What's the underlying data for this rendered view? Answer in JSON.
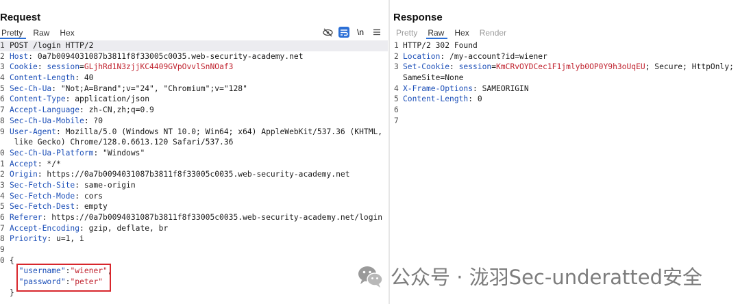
{
  "request": {
    "title": "Request",
    "tabs": [
      {
        "label": "Pretty",
        "active": true
      },
      {
        "label": "Raw",
        "active": false
      },
      {
        "label": "Hex",
        "active": false
      }
    ],
    "tools": {
      "newline_label": "\\n"
    },
    "lines": [
      {
        "n": "1",
        "parts": [
          {
            "t": "POST /login HTTP/2",
            "c": ""
          }
        ]
      },
      {
        "n": "2",
        "parts": [
          {
            "t": "Host",
            "c": "hdr"
          },
          {
            "t": ": 0a7b0094031087b3811f8f33005c0035.web-security-academy.net",
            "c": ""
          }
        ]
      },
      {
        "n": "3",
        "parts": [
          {
            "t": "Cookie",
            "c": "hdr"
          },
          {
            "t": ": ",
            "c": ""
          },
          {
            "t": "session",
            "c": "hdr"
          },
          {
            "t": "=",
            "c": ""
          },
          {
            "t": "GLjhRd1N3zjjKC4409GVpOvvlSnNOaf3",
            "c": "val"
          }
        ]
      },
      {
        "n": "4",
        "parts": [
          {
            "t": "Content-Length",
            "c": "hdr"
          },
          {
            "t": ": 40",
            "c": ""
          }
        ]
      },
      {
        "n": "5",
        "parts": [
          {
            "t": "Sec-Ch-Ua",
            "c": "hdr"
          },
          {
            "t": ": \"Not;A=Brand\";v=\"24\", \"Chromium\";v=\"128\"",
            "c": ""
          }
        ]
      },
      {
        "n": "6",
        "parts": [
          {
            "t": "Content-Type",
            "c": "hdr"
          },
          {
            "t": ": application/json",
            "c": ""
          }
        ]
      },
      {
        "n": "7",
        "parts": [
          {
            "t": "Accept-Language",
            "c": "hdr"
          },
          {
            "t": ": zh-CN,zh;q=0.9",
            "c": ""
          }
        ]
      },
      {
        "n": "8",
        "parts": [
          {
            "t": "Sec-Ch-Ua-Mobile",
            "c": "hdr"
          },
          {
            "t": ": ?0",
            "c": ""
          }
        ]
      },
      {
        "n": "9",
        "parts": [
          {
            "t": "User-Agent",
            "c": "hdr"
          },
          {
            "t": ": Mozilla/5.0 (Windows NT 10.0; Win64; x64) AppleWebKit/537.36 (KHTML,",
            "c": ""
          }
        ]
      },
      {
        "n": "",
        "parts": [
          {
            "t": " like Gecko) Chrome/128.0.6613.120 Safari/537.36",
            "c": ""
          }
        ]
      },
      {
        "n": "0",
        "parts": [
          {
            "t": "Sec-Ch-Ua-Platform",
            "c": "hdr"
          },
          {
            "t": ": \"Windows\"",
            "c": ""
          }
        ]
      },
      {
        "n": "1",
        "parts": [
          {
            "t": "Accept",
            "c": "hdr"
          },
          {
            "t": ": */*",
            "c": ""
          }
        ]
      },
      {
        "n": "2",
        "parts": [
          {
            "t": "Origin",
            "c": "hdr"
          },
          {
            "t": ": https://0a7b0094031087b3811f8f33005c0035.web-security-academy.net",
            "c": ""
          }
        ]
      },
      {
        "n": "3",
        "parts": [
          {
            "t": "Sec-Fetch-Site",
            "c": "hdr"
          },
          {
            "t": ": same-origin",
            "c": ""
          }
        ]
      },
      {
        "n": "4",
        "parts": [
          {
            "t": "Sec-Fetch-Mode",
            "c": "hdr"
          },
          {
            "t": ": cors",
            "c": ""
          }
        ]
      },
      {
        "n": "5",
        "parts": [
          {
            "t": "Sec-Fetch-Dest",
            "c": "hdr"
          },
          {
            "t": ": empty",
            "c": ""
          }
        ]
      },
      {
        "n": "6",
        "parts": [
          {
            "t": "Referer",
            "c": "hdr"
          },
          {
            "t": ": https://0a7b0094031087b3811f8f33005c0035.web-security-academy.net/login",
            "c": ""
          }
        ]
      },
      {
        "n": "7",
        "parts": [
          {
            "t": "Accept-Encoding",
            "c": "hdr"
          },
          {
            "t": ": gzip, deflate, br",
            "c": ""
          }
        ]
      },
      {
        "n": "8",
        "parts": [
          {
            "t": "Priority",
            "c": "hdr"
          },
          {
            "t": ": u=1, i",
            "c": ""
          }
        ]
      },
      {
        "n": "9",
        "parts": [
          {
            "t": "",
            "c": ""
          }
        ]
      },
      {
        "n": "0",
        "parts": [
          {
            "t": "{",
            "c": ""
          }
        ]
      },
      {
        "n": "",
        "parts": [
          {
            "t": "  ",
            "c": ""
          },
          {
            "t": "\"username\"",
            "c": "jkey"
          },
          {
            "t": ":",
            "c": ""
          },
          {
            "t": "\"wiener\"",
            "c": "jstr"
          },
          {
            "t": ",",
            "c": ""
          }
        ]
      },
      {
        "n": "",
        "parts": [
          {
            "t": "  ",
            "c": ""
          },
          {
            "t": "\"password\"",
            "c": "jkey"
          },
          {
            "t": ":",
            "c": ""
          },
          {
            "t": "\"peter\"",
            "c": "jstr"
          }
        ]
      },
      {
        "n": "",
        "parts": [
          {
            "t": "}",
            "c": ""
          }
        ]
      }
    ]
  },
  "response": {
    "title": "Response",
    "tabs": [
      {
        "label": "Pretty",
        "active": false,
        "disabled": true
      },
      {
        "label": "Raw",
        "active": true
      },
      {
        "label": "Hex",
        "active": false
      },
      {
        "label": "Render",
        "active": false,
        "disabled": true
      }
    ],
    "lines": [
      {
        "n": "1",
        "parts": [
          {
            "t": "HTTP/2 302 Found",
            "c": ""
          }
        ]
      },
      {
        "n": "2",
        "parts": [
          {
            "t": "Location",
            "c": "hdr"
          },
          {
            "t": ": /my-account?id=wiener",
            "c": ""
          }
        ]
      },
      {
        "n": "3",
        "parts": [
          {
            "t": "Set-Cookie",
            "c": "hdr"
          },
          {
            "t": ": ",
            "c": ""
          },
          {
            "t": "session",
            "c": "hdr"
          },
          {
            "t": "=",
            "c": ""
          },
          {
            "t": "KmCRvOYDCec1F1jmlyb0OP0Y9h3oUqEU",
            "c": "val"
          },
          {
            "t": "; Secure; HttpOnly;",
            "c": ""
          }
        ]
      },
      {
        "n": "",
        "parts": [
          {
            "t": "SameSite=None",
            "c": ""
          }
        ]
      },
      {
        "n": "4",
        "parts": [
          {
            "t": "X-Frame-Options",
            "c": "hdr"
          },
          {
            "t": ": SAMEORIGIN",
            "c": ""
          }
        ]
      },
      {
        "n": "5",
        "parts": [
          {
            "t": "Content-Length",
            "c": "hdr"
          },
          {
            "t": ": 0",
            "c": ""
          }
        ]
      },
      {
        "n": "6",
        "parts": [
          {
            "t": "",
            "c": ""
          }
        ]
      },
      {
        "n": "7",
        "parts": [
          {
            "t": "",
            "c": ""
          }
        ]
      }
    ]
  },
  "watermark": {
    "text": "公众号 · 泷羽Sec-underatted安全"
  },
  "colors": {
    "accent": "#2b6fd6",
    "header_name": "#1c4fb8",
    "value": "#c0232f",
    "highlight_box": "#d8262c"
  }
}
